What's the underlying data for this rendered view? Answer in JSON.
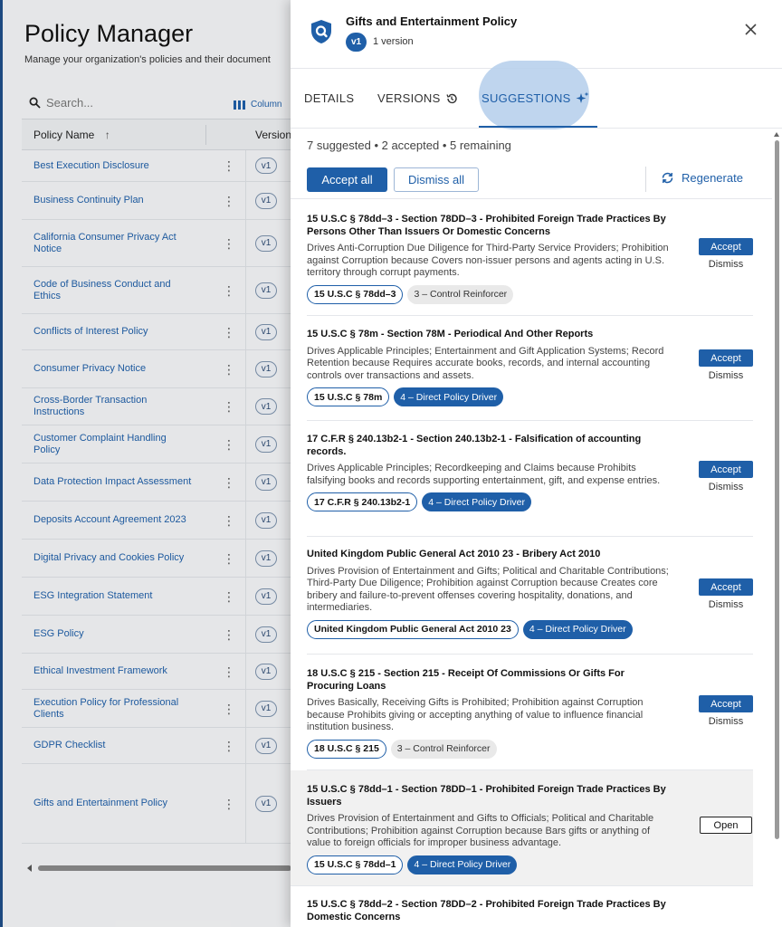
{
  "background": {
    "title": "Policy Manager",
    "subtitle": "Manage your organization's policies and their document",
    "search_placeholder": "Search...",
    "columns_label": "Column",
    "header_name": "Policy Name",
    "header_version": "Version",
    "rows": [
      {
        "name": "Best Execution Disclosure",
        "ver": "v1"
      },
      {
        "name": "Business Continuity Plan",
        "ver": "v1"
      },
      {
        "name": "California Consumer Privacy Act Notice",
        "ver": "v1"
      },
      {
        "name": "Code of Business Conduct and Ethics",
        "ver": "v1"
      },
      {
        "name": "Conflicts of Interest Policy",
        "ver": "v1"
      },
      {
        "name": "Consumer Privacy Notice",
        "ver": "v1"
      },
      {
        "name": "Cross-Border Transaction Instructions",
        "ver": "v1"
      },
      {
        "name": "Customer Complaint Handling Policy",
        "ver": "v1"
      },
      {
        "name": "Data Protection Impact Assessment",
        "ver": "v1"
      },
      {
        "name": "Deposits Account Agreement 2023",
        "ver": "v1"
      },
      {
        "name": "Digital Privacy and Cookies Policy",
        "ver": "v1"
      },
      {
        "name": "ESG Integration Statement",
        "ver": "v1"
      },
      {
        "name": "ESG Policy",
        "ver": "v1"
      },
      {
        "name": "Ethical Investment Framework",
        "ver": "v1"
      },
      {
        "name": "Execution Policy for Professional Clients",
        "ver": "v1"
      },
      {
        "name": "GDPR Checklist",
        "ver": "v1"
      },
      {
        "name": "Gifts and Entertainment Policy",
        "ver": "v1"
      }
    ]
  },
  "drawer": {
    "title": "Gifts and Entertainment Policy",
    "version_chip": "v1",
    "version_count": "1 version",
    "tabs": {
      "details": "DETAILS",
      "versions": "VERSIONS",
      "suggestions": "SUGGESTIONS"
    },
    "summary": "7 suggested • 2 accepted • 5 remaining",
    "accept_all": "Accept all",
    "dismiss_all": "Dismiss all",
    "regenerate": "Regenerate",
    "accept_label": "Accept",
    "dismiss_label": "Dismiss",
    "open_label": "Open",
    "suggestions": [
      {
        "title": "15 U.S.C § 78dd–3 - Section 78DD–3 - Prohibited Foreign Trade Practices By Persons Other Than Issuers Or Domestic Concerns",
        "desc": "Drives Anti-Corruption Due Diligence for Third-Party Service Providers; Prohibition against Corruption because Covers non-issuer persons and agents acting in U.S. territory through corrupt payments.",
        "code": "15 U.S.C § 78dd–3",
        "level": "3 – Control Reinforcer",
        "level_type": "reinforcer",
        "state": "pending"
      },
      {
        "title": "15 U.S.C § 78m - Section 78M - Periodical And Other Reports",
        "desc": "Drives Applicable Principles; Entertainment and Gift Application Systems; Record Retention because Requires accurate books, records, and internal accounting controls over transactions and assets.",
        "code": "15 U.S.C § 78m",
        "level": "4 – Direct Policy Driver",
        "level_type": "driver",
        "state": "pending"
      },
      {
        "title": "17 C.F.R § 240.13b2-1 - Section 240.13b2-1 - Falsification of accounting records.",
        "desc": "Drives Applicable Principles; Recordkeeping and Claims because Prohibits falsifying books and records supporting entertainment, gift, and expense entries.",
        "code": "17 C.F.R § 240.13b2-1",
        "level": "4 – Direct Policy Driver",
        "level_type": "driver",
        "state": "pending"
      },
      {
        "title": "United Kingdom Public General Act 2010 23 - Bribery Act 2010",
        "desc": "Drives Provision of Entertainment and Gifts; Political and Charitable Contributions; Third-Party Due Diligence; Prohibition against Corruption because Creates core bribery and failure-to-prevent offenses covering hospitality, donations, and intermediaries.",
        "code": "United Kingdom Public General Act 2010 23",
        "level": "4 – Direct Policy Driver",
        "level_type": "driver",
        "state": "pending"
      },
      {
        "title": "18 U.S.C § 215 - Section 215 - Receipt Of Commissions Or Gifts For Procuring Loans",
        "desc": "Drives Basically, Receiving Gifts is Prohibited; Prohibition against Corruption because Prohibits giving or accepting anything of value to influence financial institution business.",
        "code": "18 U.S.C § 215",
        "level": "3 – Control Reinforcer",
        "level_type": "reinforcer",
        "state": "pending"
      },
      {
        "title": "15 U.S.C § 78dd–1 - Section 78DD–1 - Prohibited Foreign Trade Practices By Issuers",
        "desc": "Drives Provision of Entertainment and Gifts to Officials; Political and Charitable Contributions; Prohibition against Corruption because Bars gifts or anything of value to foreign officials for improper business advantage.",
        "code": "15 U.S.C § 78dd–1",
        "level": "4 – Direct Policy Driver",
        "level_type": "driver",
        "state": "accepted"
      },
      {
        "title": "15 U.S.C § 78dd–2 - Section 78DD–2 - Prohibited Foreign Trade Practices By Domestic Concerns",
        "desc": "",
        "code": "",
        "level": "",
        "level_type": "",
        "state": "accepted"
      }
    ]
  },
  "colors": {
    "accent": "#1f5fa8",
    "highlight_row": "#f1f1f1",
    "tab_ripple": "#b8d0ec"
  }
}
